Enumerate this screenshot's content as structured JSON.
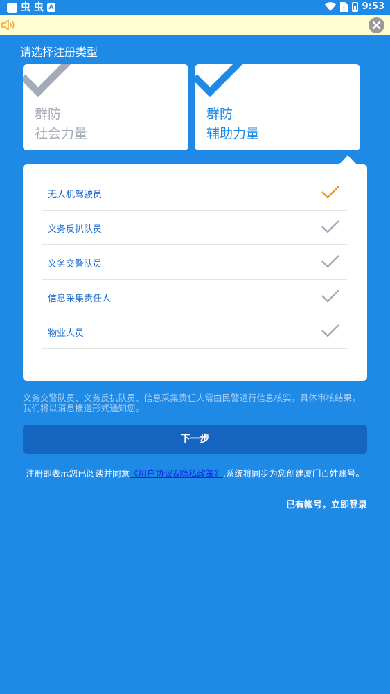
{
  "status_bar": {
    "app_icons": [
      "虫",
      "虫"
    ],
    "time": "9:53"
  },
  "notice_bar": {
    "speaker_icon": "speaker-icon",
    "close_icon": "close-icon"
  },
  "page": {
    "title": "请选择注册类型"
  },
  "type_cards": [
    {
      "line1": "群防",
      "line2": "社会力量",
      "selected": false
    },
    {
      "line1": "群防",
      "line2": "辅助力量",
      "selected": true
    }
  ],
  "roles": [
    {
      "label": "无人机驾驶员",
      "selected": true
    },
    {
      "label": "义务反扒队员",
      "selected": false
    },
    {
      "label": "义务交警队员",
      "selected": false
    },
    {
      "label": "信息采集责任人",
      "selected": false
    },
    {
      "label": "物业人员",
      "selected": false
    }
  ],
  "hint": "义务交警队员、义务反扒队员、信息采集责任人需由民警进行信息核实，具体审核结果，我们将以消息推送形式通知您。",
  "next_button": "下一步",
  "agreement": {
    "prefix": "注册即表示您已阅读并同意",
    "link": "《用户协议&隐私政策》",
    "suffix": ",系统将同步为您创建厦门百姓账号。"
  },
  "login_link": "已有帐号，立即登录",
  "colors": {
    "background": "#1E8AE6",
    "selected_check": "#F0922E",
    "unselected_check": "#A3ABB6",
    "button": "#1565C0"
  }
}
